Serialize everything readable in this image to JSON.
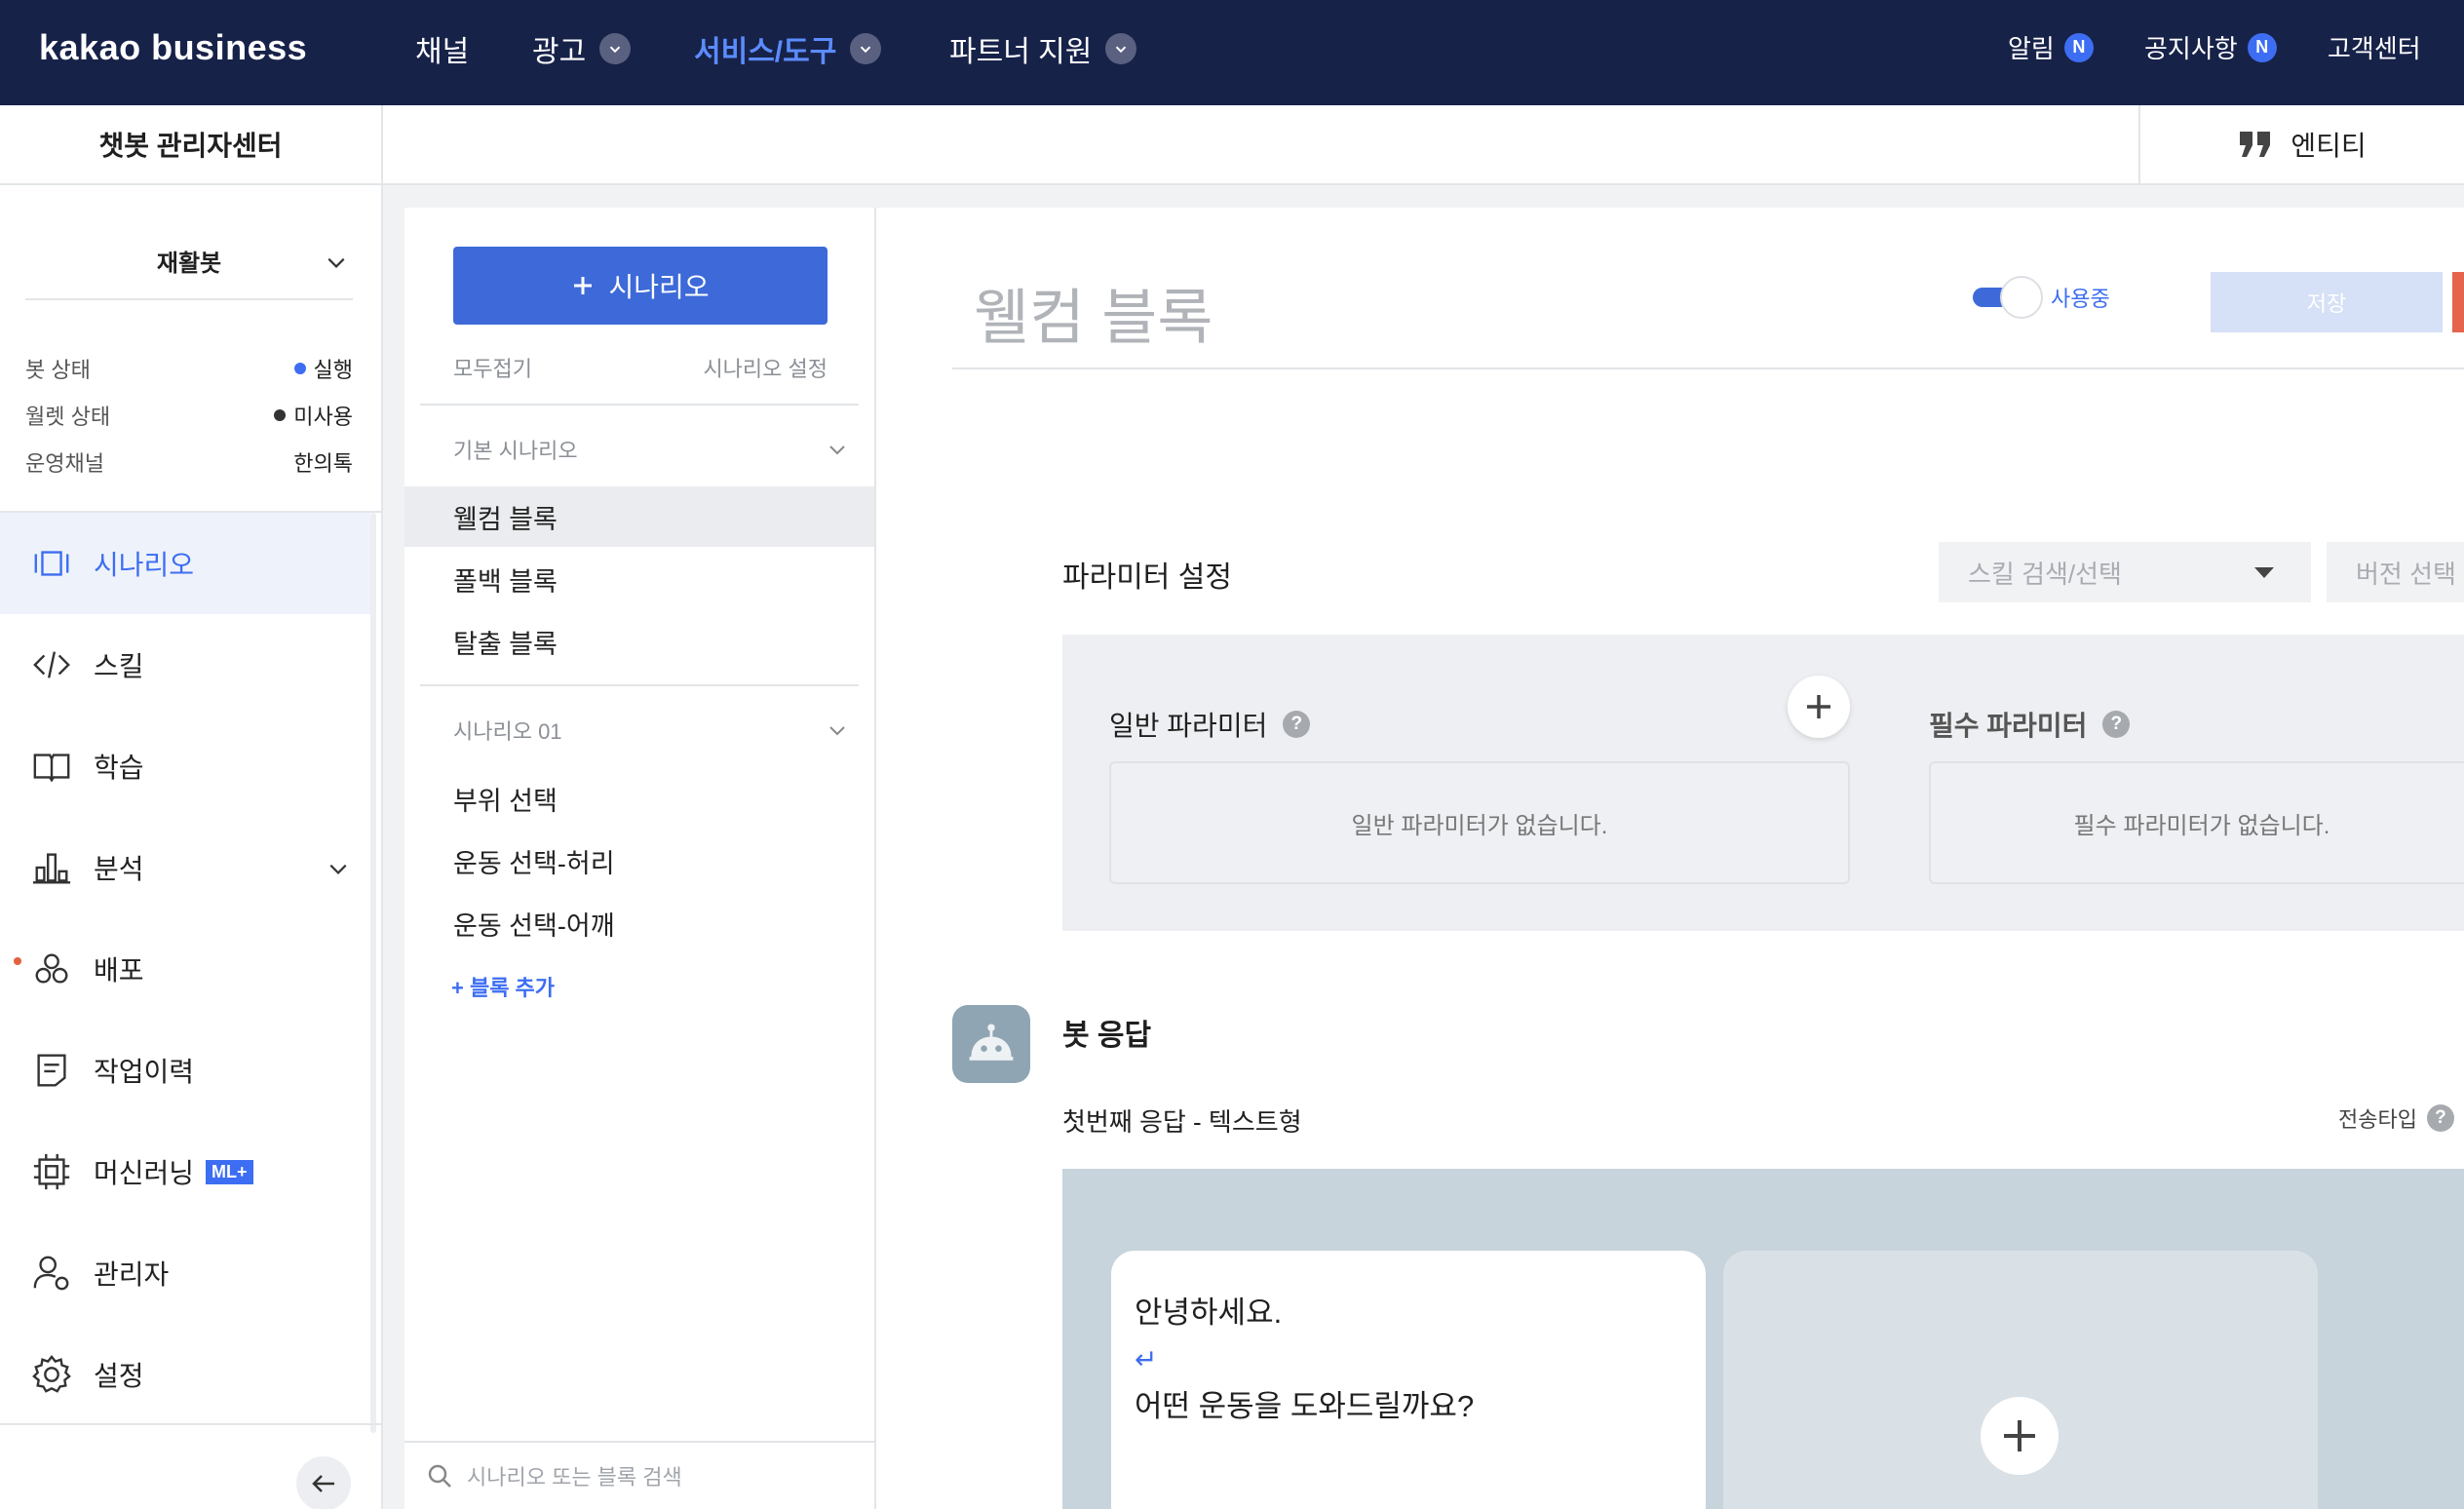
{
  "topbar": {
    "logo": "kakao business",
    "nav": [
      {
        "label": "채널"
      },
      {
        "label": "광고"
      },
      {
        "label": "서비스/도구"
      },
      {
        "label": "파트너 지원"
      }
    ],
    "right": {
      "alarm": "알림",
      "notice": "공지사항",
      "badge": "N",
      "support": "고객센터"
    }
  },
  "sidebar": {
    "title": "챗봇 관리자센터",
    "bot_name": "재활봇",
    "status": [
      {
        "label": "봇 상태",
        "value": "실행",
        "dot_color": "#3d6df2"
      },
      {
        "label": "월렛 상태",
        "value": "미사용",
        "dot_color": "#333333"
      },
      {
        "label": "운영채널",
        "value": "한의톡"
      }
    ],
    "menu": [
      {
        "label": "시나리오",
        "icon": "scenario-icon"
      },
      {
        "label": "스킬",
        "icon": "code-icon"
      },
      {
        "label": "학습",
        "icon": "book-icon"
      },
      {
        "label": "분석",
        "icon": "chart-icon"
      },
      {
        "label": "배포",
        "icon": "deploy-icon"
      },
      {
        "label": "작업이력",
        "icon": "history-icon"
      },
      {
        "label": "머신러닝",
        "icon": "chip-icon",
        "badge": "ML+"
      },
      {
        "label": "관리자",
        "icon": "admin-icon"
      },
      {
        "label": "설정",
        "icon": "gear-icon"
      }
    ]
  },
  "subheader": {
    "entity_tab": "엔티티"
  },
  "scenarios": {
    "add_button": "시나리오",
    "collapse_all": "모두접기",
    "settings": "시나리오 설정",
    "groups": [
      {
        "title": "기본 시나리오",
        "blocks": [
          "웰컴 블록",
          "폴백 블록",
          "탈출 블록"
        ]
      },
      {
        "title": "시나리오 01",
        "blocks": [
          "부위 선택",
          "운동 선택-허리",
          "운동 선택-어깨"
        ]
      }
    ],
    "add_block": "+ 블록 추가",
    "search_placeholder": "시나리오 또는 블록 검색"
  },
  "editor": {
    "block_title": "웰컴 블록",
    "toggle_label": "사용중",
    "save_label": "저장",
    "param_section": "파라미터 설정",
    "skill_select": "스킬 검색/선택",
    "version_select": "버전 선택",
    "general_param": "일반 파라미터",
    "general_empty": "일반 파라미터가 없습니다.",
    "required_param": "필수 파라미터",
    "required_empty": "필수 파라미터가 없습니다.",
    "bot_response": "봇 응답",
    "first_response": "첫번째 응답 - 텍스트형",
    "send_type": "전송타입",
    "message_line1": "안녕하세요.",
    "message_enter": "↵",
    "message_line2": "어떤 운동을 도와드릴까요?"
  },
  "colors": {
    "topbar_bg": "#172249",
    "accent": "#3d6df2",
    "danger": "#e5644b"
  }
}
